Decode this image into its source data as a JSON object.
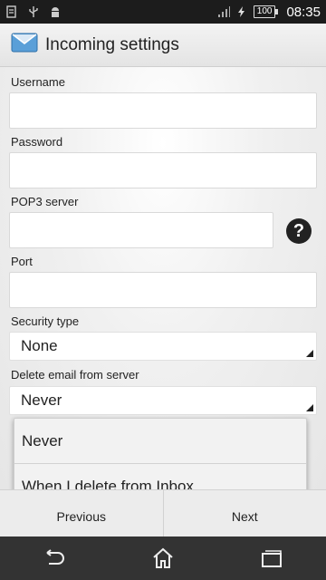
{
  "status_bar": {
    "icons": [
      "notification-icon",
      "usb-icon",
      "android-icon",
      "signal-icon",
      "charging-icon"
    ],
    "battery": "100",
    "time": "08:35"
  },
  "action_bar": {
    "icon": "email-icon",
    "title": "Incoming settings"
  },
  "form": {
    "username_label": "Username",
    "username_value": "",
    "password_label": "Password",
    "password_value": "",
    "pop3_label": "POP3 server",
    "pop3_value": "",
    "help_label": "?",
    "port_label": "Port",
    "port_value": "",
    "security_label": "Security type",
    "security_value": "None",
    "delete_label": "Delete email from server",
    "delete_value": "Never"
  },
  "dropdown": {
    "options": [
      "Never",
      "When I delete from Inbox"
    ]
  },
  "buttons": {
    "previous": "Previous",
    "next": "Next"
  },
  "nav_bar": {
    "icons": [
      "back-icon",
      "home-icon",
      "recent-apps-icon"
    ]
  },
  "colors": {
    "status_bar": "#1c1c1c",
    "nav_bar": "#333333",
    "help_button": "#222222"
  }
}
